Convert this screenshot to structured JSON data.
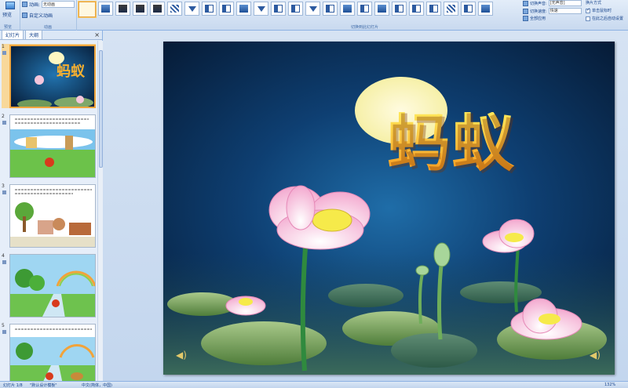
{
  "ribbon": {
    "preview_label": "预览",
    "preview_group": "预览",
    "anim_label": "动画:",
    "anim_value": "无动画",
    "custom_anim_label": "自定义动画",
    "anim_group": "动画",
    "gallery_group": "切换到此幻灯片",
    "sound_label": "切换声音:",
    "sound_value": "[无声音]",
    "speed_label": "切换速度:",
    "speed_value": "快速",
    "apply_all_label": "全部应用",
    "advance_label": "换片方式",
    "on_click_label": "单击鼠标时",
    "after_label": "在此之后自动设置"
  },
  "pane": {
    "tab_slides": "幻灯片",
    "tab_outline": "大纲",
    "close": "×"
  },
  "slides": [
    {
      "num": "1"
    },
    {
      "num": "2"
    },
    {
      "num": "3"
    },
    {
      "num": "4"
    },
    {
      "num": "5"
    }
  ],
  "slide": {
    "title": "蚂蚁"
  },
  "status": {
    "slide_pos": "幻灯片 1/8",
    "theme": "\"默认设计模板\"",
    "lang": "中文(简体，中国)",
    "zoom": "132%"
  },
  "colors": {
    "ribbon_bg": "#dbe7f6",
    "accent": "#f0a53d",
    "slide_bg": "#0e3f72",
    "title_gradient_top": "#ffe85a",
    "title_gradient_bottom": "#f89a1f"
  }
}
